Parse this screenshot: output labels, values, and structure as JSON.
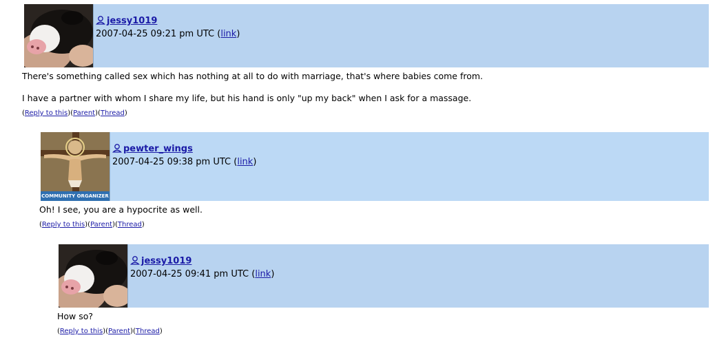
{
  "comments": [
    {
      "username": "jessy1019",
      "timestamp": "2007-04-25 09:21 pm UTC",
      "link_label": "link",
      "avatar_icon": "puppy-photo",
      "paragraphs": [
        "There's something called sex which has nothing at all to do with marriage, that's where babies come from.",
        "I have a partner with whom I share my life, but his hand is only \"up my back\" when I ask for a massage."
      ],
      "actions": {
        "reply": "Reply to this",
        "parent": "Parent",
        "thread": "Thread"
      }
    },
    {
      "username": "pewter_wings",
      "timestamp": "2007-04-25 09:38 pm UTC",
      "link_label": "link",
      "avatar_icon": "crucifix-image",
      "avatar_caption": "COMMUNITY ORGANIZER",
      "paragraphs": [
        "Oh! I see, you are a hypocrite as well."
      ],
      "actions": {
        "reply": "Reply to this",
        "parent": "Parent",
        "thread": "Thread"
      }
    },
    {
      "username": "jessy1019",
      "timestamp": "2007-04-25 09:41 pm UTC",
      "link_label": "link",
      "avatar_icon": "puppy-photo",
      "paragraphs": [
        "How so?"
      ],
      "actions": {
        "reply": "Reply to this",
        "parent": "Parent",
        "thread": "Thread"
      }
    }
  ],
  "colors": {
    "header_bg": "#b8d3f0",
    "link": "#1a1aa6"
  }
}
